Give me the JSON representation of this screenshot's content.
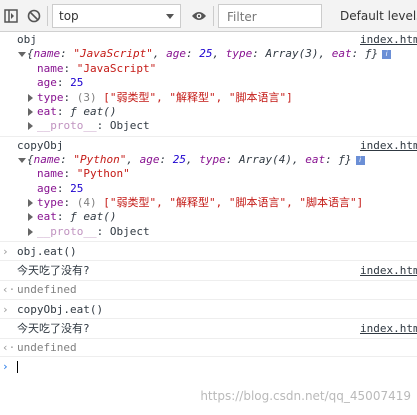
{
  "toolbar": {
    "context": "top",
    "filter_placeholder": "Filter",
    "levels": "Default levels"
  },
  "log1": {
    "label": "obj",
    "source": "index.htm",
    "summary_open": "{",
    "name_key": "name",
    "name_val": "\"JavaScript\"",
    "age_key": "age",
    "age_val": "25",
    "type_key": "type",
    "type_val": "Array(3)",
    "eat_key": "eat",
    "eat_val": "ƒ",
    "summary_close": "}",
    "prop_name_key": "name",
    "prop_name_val": "\"JavaScript\"",
    "prop_age_key": "age",
    "prop_age_val": "25",
    "prop_type_key": "type",
    "prop_type_count": "(3)",
    "prop_type_items": "[\"弱类型\", \"解释型\", \"脚本语言\"]",
    "prop_eat_key": "eat",
    "prop_eat_val": "ƒ eat()",
    "proto_key": "__proto__",
    "proto_val": "Object"
  },
  "log2": {
    "label": "copyObj",
    "source": "index.htm",
    "summary_open": "{",
    "name_key": "name",
    "name_val": "\"Python\"",
    "age_key": "age",
    "age_val": "25",
    "type_key": "type",
    "type_val": "Array(4)",
    "eat_key": "eat",
    "eat_val": "ƒ",
    "summary_close": "}",
    "prop_name_key": "name",
    "prop_name_val": "\"Python\"",
    "prop_age_key": "age",
    "prop_age_val": "25",
    "prop_type_key": "type",
    "prop_type_count": "(4)",
    "prop_type_items": "[\"弱类型\", \"解释型\", \"脚本语言\", \"脚本语言\"]",
    "prop_eat_key": "eat",
    "prop_eat_val": "ƒ eat()",
    "proto_key": "__proto__",
    "proto_val": "Object"
  },
  "cmd1": {
    "input": "obj.eat()",
    "output": "今天吃了没有?",
    "source": "index.htm",
    "result": "undefined"
  },
  "cmd2": {
    "input": "copyObj.eat()",
    "output": "今天吃了没有?",
    "source": "index.htm",
    "result": "undefined"
  },
  "watermark": "https://blog.csdn.net/qq_45007419"
}
